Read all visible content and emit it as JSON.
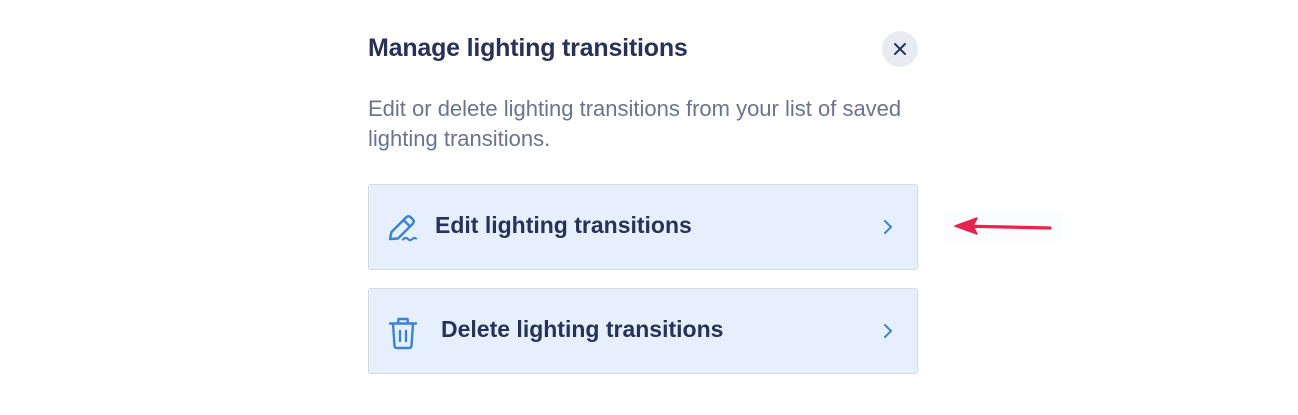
{
  "dialog": {
    "title": "Manage lighting transitions",
    "description": "Edit or delete lighting transitions from your list of saved lighting transitions.",
    "close_icon": "close-icon"
  },
  "options": [
    {
      "label": "Edit lighting transitions",
      "icon": "pencil-icon"
    },
    {
      "label": "Delete lighting transitions",
      "icon": "trash-icon"
    }
  ],
  "colors": {
    "title": "#27315a",
    "description": "#6b7390",
    "option_bg": "#e6f0fc",
    "icon_accent": "#3a83d6",
    "annotation_arrow": "#e8234e"
  }
}
